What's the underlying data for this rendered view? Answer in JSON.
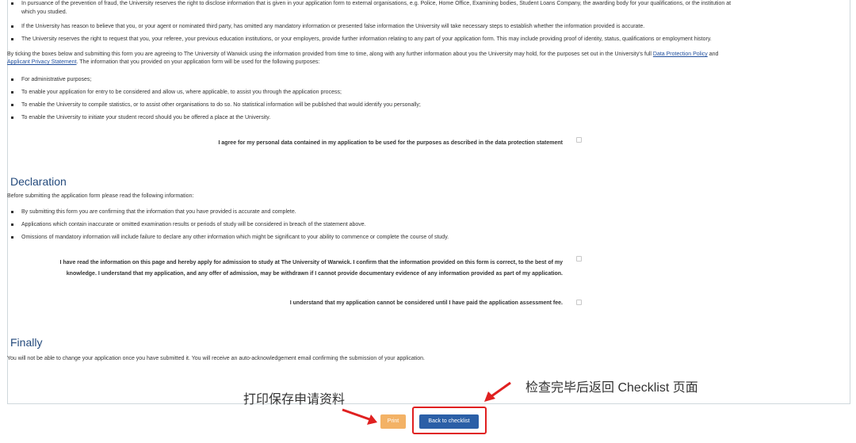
{
  "fraud_bullets": [
    "In pursuance of the prevention of fraud, the University reserves the right to disclose information that is given in your application form to external organisations, e.g. Police, Home Office, Examining bodies, Student Loans Company, the awarding body for your qualifications, or the institution at",
    "which you studied.",
    "If the University has reason to believe that you, or your agent or nominated third party, has omitted any mandatory information or presented false information the University will take necessary steps to establish whether the information provided is accurate.",
    "The University reserves the right to request that you, your referee, your previous education institutions, or your employers, provide further information relating to any part of your application form. This may include providing proof of identity, status, qualifications or employment history."
  ],
  "data_protection": {
    "intro_part1": "By ticking the boxes below and submitting this form you are agreeing to The University of Warwick using the information provided from time to time, along with any further information about you the University may hold, for the purposes set out in the University's full ",
    "link1": "Data Protection Policy",
    "and": " and",
    "link2": "Applicant Privacy Statement",
    "intro_part2": ". The information that you provided on your application form will be used for the following purposes:",
    "purposes": [
      "For administrative purposes;",
      "To enable your application for entry to be considered and allow us, where applicable, to assist you through the application process;",
      "To enable the University to compile statistics, or to assist other organisations to do so. No statistical information will be published that would identify you personally;",
      "To enable the University to initiate your student record should you be offered a place at the University."
    ],
    "agree_label": "I agree for my personal data contained in my application to be used for the purposes as described in the data protection statement"
  },
  "declaration": {
    "heading": "Declaration",
    "intro": "Before submitting the application form please read the following information:",
    "items": [
      "By submitting this form you are confirming that the information that you have provided is accurate and complete.",
      "Applications which contain inaccurate or omitted examination results or periods of study will be considered in breach of the statement above.",
      "Omissions of mandatory information will include failure to declare any other information which might be significant to your ability to commence or complete the course of study."
    ],
    "confirm_line1": "I have read the information on this page and hereby apply for admission to study at The University of Warwick. I confirm that the information provided on this form is correct, to the best of my",
    "confirm_line2": "knowledge. I understand that my application, and any offer of admission, may be withdrawn if I cannot provide documentary evidence of any information provided as part of my application.",
    "fee_label": "I understand that my application cannot be considered until I have paid the application assessment fee."
  },
  "finally": {
    "heading": "Finally",
    "text": "You will not be able to change your application once you have submitted it. You will receive an auto-acknowledgement email confirming the submission of your application."
  },
  "buttons": {
    "print": "Print",
    "back": "Back to checklist"
  },
  "annotations": {
    "print_note": "打印保存申请资料",
    "back_note": "检查完毕后返回 Checklist 页面"
  },
  "colors": {
    "heading": "#244a7c",
    "print_button": "#f3b266",
    "back_button": "#2b5fa7",
    "highlight": "#e02020",
    "arrow": "#e02020"
  }
}
